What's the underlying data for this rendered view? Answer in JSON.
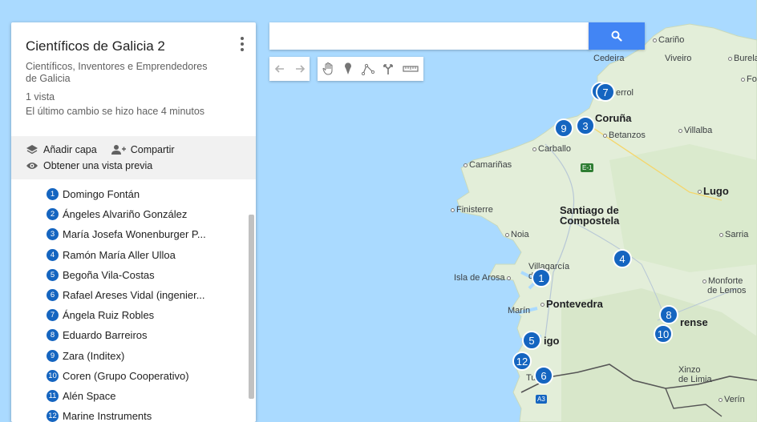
{
  "panel": {
    "title": "Científicos de Galicia 2",
    "subtitle": "Científicos, Inventores e Emprendedores de Galicia",
    "views": "1 vista",
    "last_change": "El último cambio se hizo hace 4 minutos",
    "add_layer": "Añadir capa",
    "share": "Compartir",
    "preview": "Obtener una vista previa",
    "items": [
      {
        "num": "1",
        "label": "Domingo Fontán"
      },
      {
        "num": "2",
        "label": "Ángeles Alvariño González"
      },
      {
        "num": "3",
        "label": "María Josefa Wonenburger P..."
      },
      {
        "num": "4",
        "label": "Ramón María Aller Ulloa"
      },
      {
        "num": "5",
        "label": "Begoña Vila-Costas"
      },
      {
        "num": "6",
        "label": "Rafael Areses Vidal (ingenier..."
      },
      {
        "num": "7",
        "label": "Ángela Ruiz Robles"
      },
      {
        "num": "8",
        "label": "Eduardo Barreiros"
      },
      {
        "num": "9",
        "label": "Zara (Inditex)"
      },
      {
        "num": "10",
        "label": "Coren (Grupo Cooperativo)"
      },
      {
        "num": "11",
        "label": "Alén Space"
      },
      {
        "num": "12",
        "label": "Marine Instruments"
      }
    ]
  },
  "search": {
    "value": "",
    "placeholder": ""
  },
  "toolbar": {
    "icons": [
      "undo-icon",
      "redo-icon",
      "hand-icon",
      "marker-icon",
      "draw-line-icon",
      "directions-icon",
      "ruler-icon"
    ]
  },
  "map": {
    "colors": {
      "sea": "#aadaff",
      "land": "#e3eed9",
      "accent": "#1565c0",
      "search_button": "#4285f4"
    },
    "places": {
      "carino": "Cariño",
      "viveiro": "Viveiro",
      "burela": "Burela",
      "cedeira": "Cedeira",
      "fo": "Fo",
      "ferrol": "errol",
      "coruna": "Coruña",
      "betanzos": "Betanzos",
      "villalba": "Villalba",
      "carballo": "Carballo",
      "camarinas": "Camariñas",
      "e1": "E-1",
      "lugo": "Lugo",
      "finisterre": "Finisterre",
      "santiago1": "Santiago de",
      "santiago2": "Compostela",
      "noia": "Noia",
      "sarria": "Sarria",
      "villagarcia1": "Villagarcía",
      "villagarcia2": "d    osa",
      "isla": "Isla de Arosa",
      "monforte1": "Monforte",
      "monforte2": "de Lemos",
      "marin": "Marín",
      "pontevedra": "Pontevedra",
      "ourense": "rense",
      "vigo": "igo",
      "xinzo1": "Xinzo",
      "xinzo2": "de Limia",
      "tui": "Tu",
      "a3": "A3",
      "verin": "Verín"
    },
    "markers": [
      "7",
      "9",
      "3",
      "4",
      "1",
      "8",
      "10",
      "5",
      "12",
      "6"
    ]
  }
}
